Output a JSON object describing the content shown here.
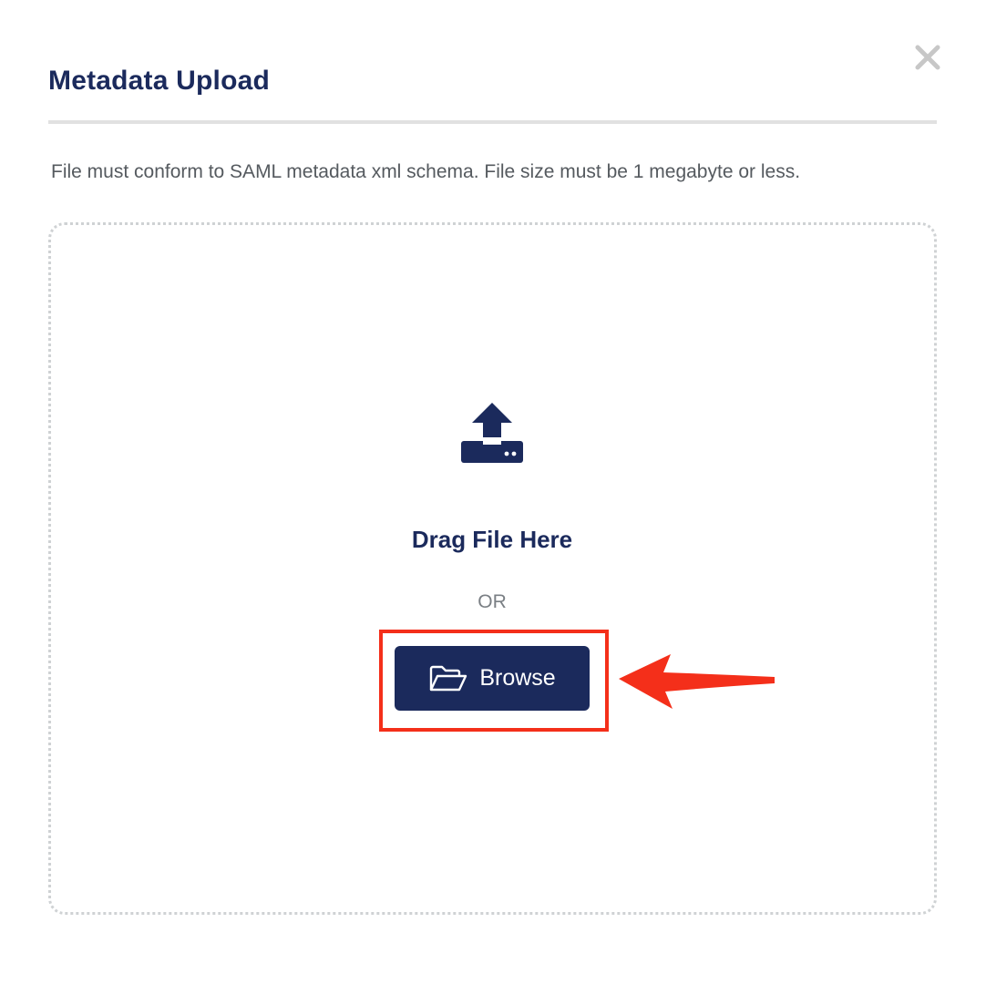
{
  "dialog": {
    "title": "Metadata Upload",
    "close_icon": "close-icon",
    "hint": "File must conform to SAML metadata xml schema. File size must be 1 megabyte or less."
  },
  "dropzone": {
    "upload_icon": "upload-icon",
    "drag_text": "Drag File Here",
    "or_text": "OR",
    "browse": {
      "label": "Browse",
      "icon": "folder-open-icon"
    }
  },
  "annotation": {
    "highlight_color": "#f42f1a",
    "arrow_color": "#f42f1a"
  },
  "colors": {
    "primary": "#1b2a5c",
    "divider": "#e1e1e1",
    "dropzone_border": "#cfd2d4"
  }
}
